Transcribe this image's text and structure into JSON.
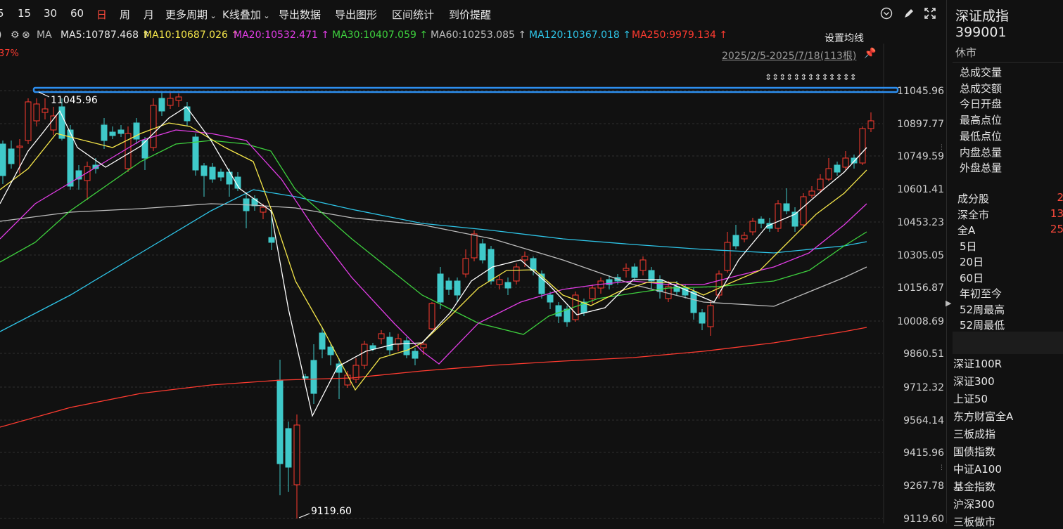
{
  "toolbar": {
    "periods": [
      "5",
      "15",
      "30",
      "60",
      "日",
      "周",
      "月"
    ],
    "active_period": "日",
    "more_periods": "更多周期",
    "kline_overlay": "K线叠加",
    "export_data": "导出数据",
    "export_chart": "导出图形",
    "range_stats": "区间统计",
    "price_alert": "到价提醒"
  },
  "ma_row": {
    "label": "MA",
    "items": [
      {
        "text": "MA5:10787.468",
        "arrow": "↑",
        "color": "#e6e6e6"
      },
      {
        "text": "MA10:10687.026",
        "arrow": "↑",
        "color": "#f5e64a"
      },
      {
        "text": "MA20:10532.471",
        "arrow": "↑",
        "color": "#e23de6"
      },
      {
        "text": "MA30:10407.059",
        "arrow": "↑",
        "color": "#3ed13e"
      },
      {
        "text": "MA60:10253.085",
        "arrow": "↑",
        "color": "#bdbdbd"
      },
      {
        "text": "MA120:10367.018",
        "arrow": "↑",
        "color": "#2ec5e8"
      },
      {
        "text": "MA250:9979.134",
        "arrow": "↑",
        "color": "#ff3b30"
      }
    ],
    "settings": "设置均线",
    "left_pct": "37%",
    "date_range": "2025/2/5-2025/7/18(113根)"
  },
  "chart_data": {
    "type": "candlestick",
    "y_ticks": [
      "11045.96",
      "10897.77",
      "10749.59",
      "10601.41",
      "10453.23",
      "10305.05",
      "10156.87",
      "10008.69",
      "9860.51",
      "9712.32",
      "9564.14",
      "9415.96",
      "9267.78",
      "9119.60"
    ],
    "ylim": [
      9119.6,
      11045.96
    ],
    "high_label": "11045.96",
    "low_label": "9119.60",
    "colors": {
      "up": "#ff3b30",
      "down": "#3fc9c9",
      "ma5": "#ffffff",
      "ma10": "#f5e64a",
      "ma20": "#e23de6",
      "ma30": "#3ed13e",
      "ma60": "#bdbdbd",
      "ma120": "#2ec5e8",
      "ma250": "#ff3b30",
      "hline": "#2d8ff0"
    }
  },
  "panel": {
    "name": "深证成指",
    "code": "399001",
    "status": "休市",
    "stats": [
      "总成交量",
      "总成交额",
      "今日开盘",
      "最高点位",
      "最低点位",
      "内盘总量",
      "外盘总量"
    ],
    "breadth": [
      {
        "label": "成分股",
        "value": "2"
      },
      {
        "label": "深全市",
        "value": "13"
      },
      {
        "label": "全A",
        "value": "25"
      }
    ],
    "periods": [
      "5日",
      "20日",
      "60日",
      "年初至今",
      "52周最高",
      "52周最低"
    ],
    "related": [
      "深证100R",
      "深证300",
      "上证50",
      "东方财富全A",
      "三板成指",
      "国债指数",
      "中证A100",
      "基金指数",
      "沪深300",
      "三板做市"
    ]
  }
}
